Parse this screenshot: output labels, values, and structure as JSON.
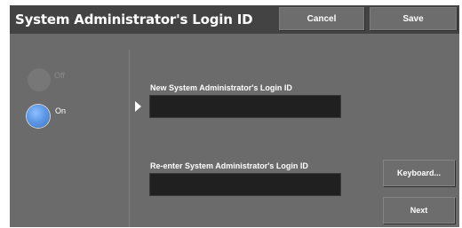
{
  "header": {
    "title": "System Administrator's Login ID",
    "cancel_label": "Cancel",
    "save_label": "Save"
  },
  "toggle": {
    "options": [
      {
        "label": "Off",
        "selected": false
      },
      {
        "label": "On",
        "selected": true
      }
    ]
  },
  "form": {
    "new_id_label": "New System Administrator's Login ID",
    "new_id_value": "",
    "reenter_label": "Re-enter System Administrator's Login ID",
    "reenter_value": ""
  },
  "buttons": {
    "keyboard_label": "Keyboard...",
    "next_label": "Next"
  },
  "colors": {
    "header_bg": "#434343",
    "panel_bg": "#6b6b6b",
    "field_bg": "#202020",
    "selected_radio": "#5d98e6"
  }
}
